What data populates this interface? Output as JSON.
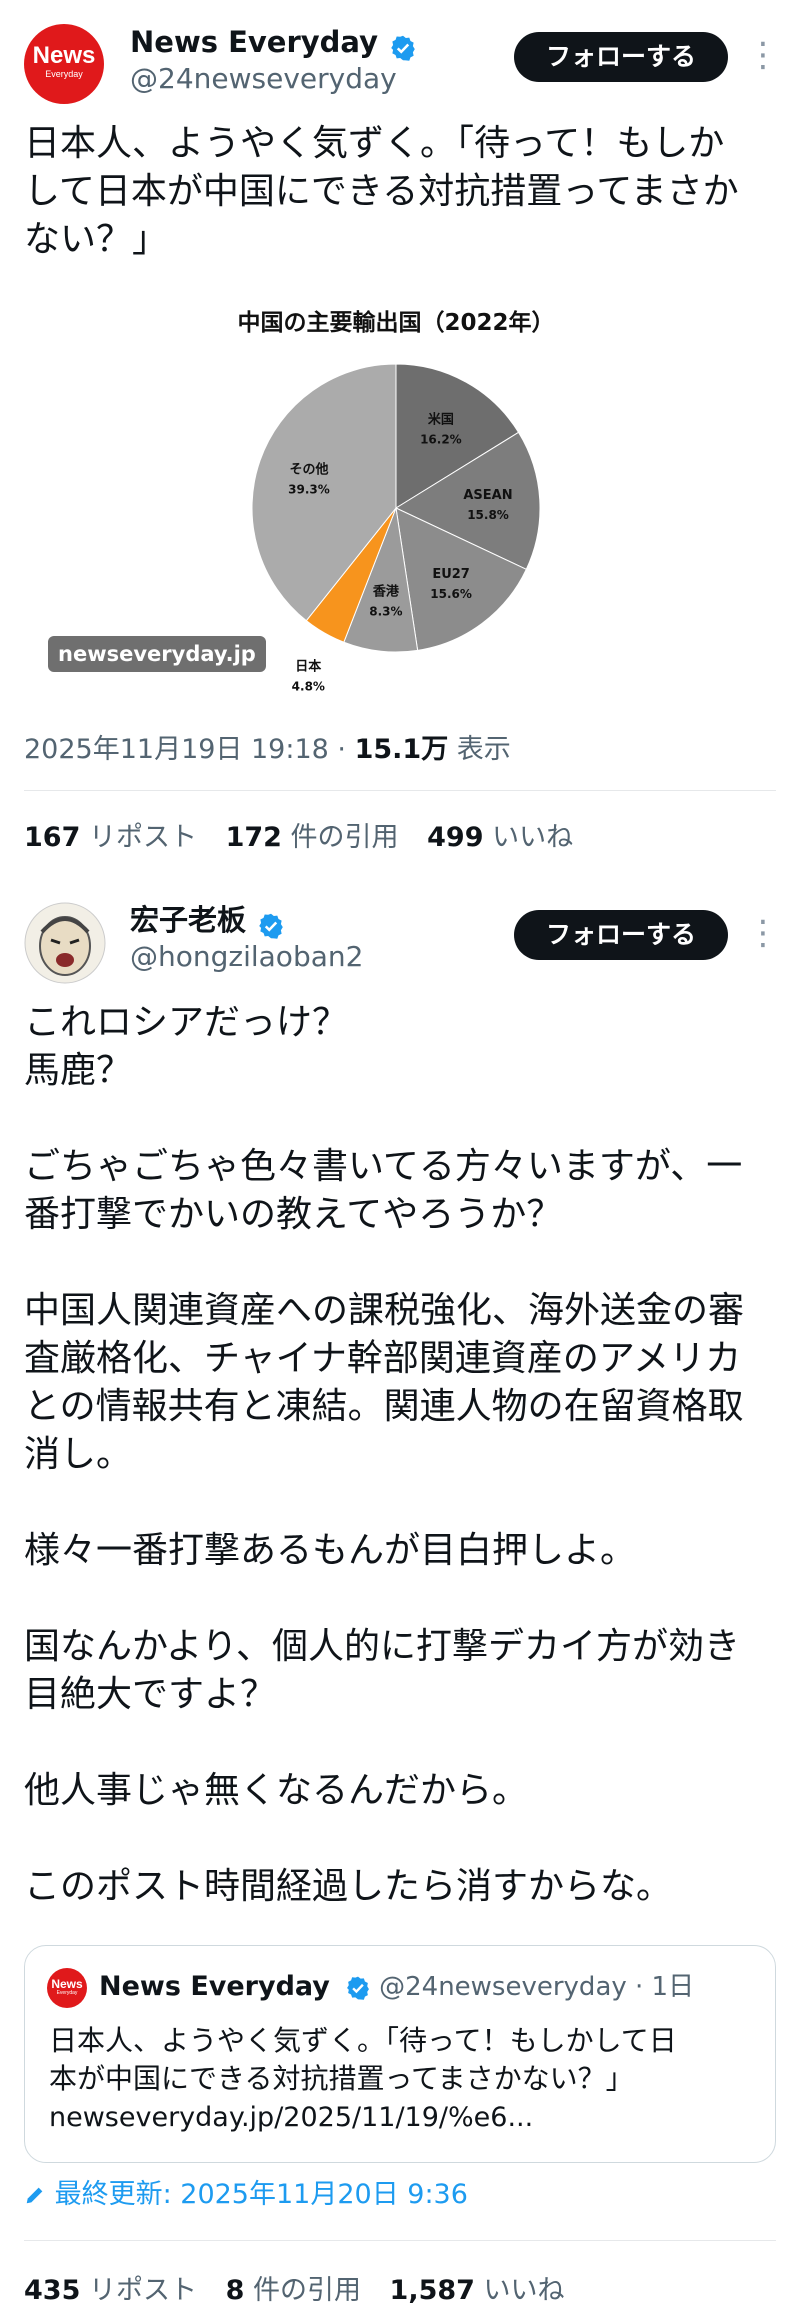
{
  "tweet1": {
    "avatar_text": "News",
    "avatar_subtext": "Everyday",
    "name": "News Everyday",
    "handle": "@24newseveryday",
    "follow_label": "フォローする",
    "more_icon": "⋮",
    "text": "日本人、ようやく気ずく。「待って！もしか\nして日本が中国にできる対抗措置ってまさか\nない？」",
    "watermark": "newseveryday.jp",
    "timestamp": "2025年11月19日 19:18 · ",
    "views_count": "15.1万",
    "views_label": " 表示",
    "stats": [
      {
        "count": "167",
        "label": " リポスト"
      },
      {
        "count": "172",
        "label": " 件の引用"
      },
      {
        "count": "499",
        "label": " いいね"
      }
    ]
  },
  "chart_data": {
    "type": "pie",
    "title": "中国の主要輸出国（2022年）",
    "slices": [
      {
        "label": "米国",
        "value": 16.2,
        "value_label": "16.2%",
        "color": "#6e6e6e"
      },
      {
        "label": "ASEAN",
        "value": 15.8,
        "value_label": "15.8%",
        "color": "#7d7d7d"
      },
      {
        "label": "EU27",
        "value": 15.6,
        "value_label": "15.6%",
        "color": "#8c8c8c"
      },
      {
        "label": "香港",
        "value": 8.3,
        "value_label": "8.3%",
        "color": "#9b9b9b"
      },
      {
        "label": "日本",
        "value": 4.8,
        "value_label": "4.8%",
        "color": "#f7941d"
      },
      {
        "label": "その他",
        "value": 39.3,
        "value_label": "39.3%",
        "color": "#ababab"
      }
    ]
  },
  "tweet2": {
    "name": "宏子老板",
    "handle": "@hongzilaoban2",
    "follow_label": "フォローする",
    "more_icon": "⋮",
    "text": "これロシアだっけ？\n馬鹿？\n\nごちゃごちゃ色々書いてる方々いますが、一\n番打撃でかいの教えてやろうか？\n\n中国人関連資産への課税強化、海外送金の審\n査厳格化、チャイナ幹部関連資産のアメリカ\nとの情報共有と凍結。関連人物の在留資格取\n消し。\n\n様々一番打撃あるもんが目白押しよ。\n\n国なんかより、個人的に打撃デカイ方が効き\n目絶大ですよ？\n\n他人事じゃ無くなるんだから。\n\nこのポスト時間経過したら消すからな。",
    "quote": {
      "name": "News Everyday",
      "handle": "@24newseveryday",
      "time": " · 1日",
      "text": "日本人、ようやく気ずく。「待って！もしかして日\n本が中国にできる対抗措置ってまさかない？」",
      "link": "newseveryday.jp/2025/11/19/%e6..."
    },
    "last_updated": "最終更新: 2025年11月20日 9:36",
    "stats": [
      {
        "count": "435",
        "label": " リポスト"
      },
      {
        "count": "8",
        "label": " 件の引用"
      },
      {
        "count": "1,587",
        "label": " いいね"
      }
    ]
  }
}
